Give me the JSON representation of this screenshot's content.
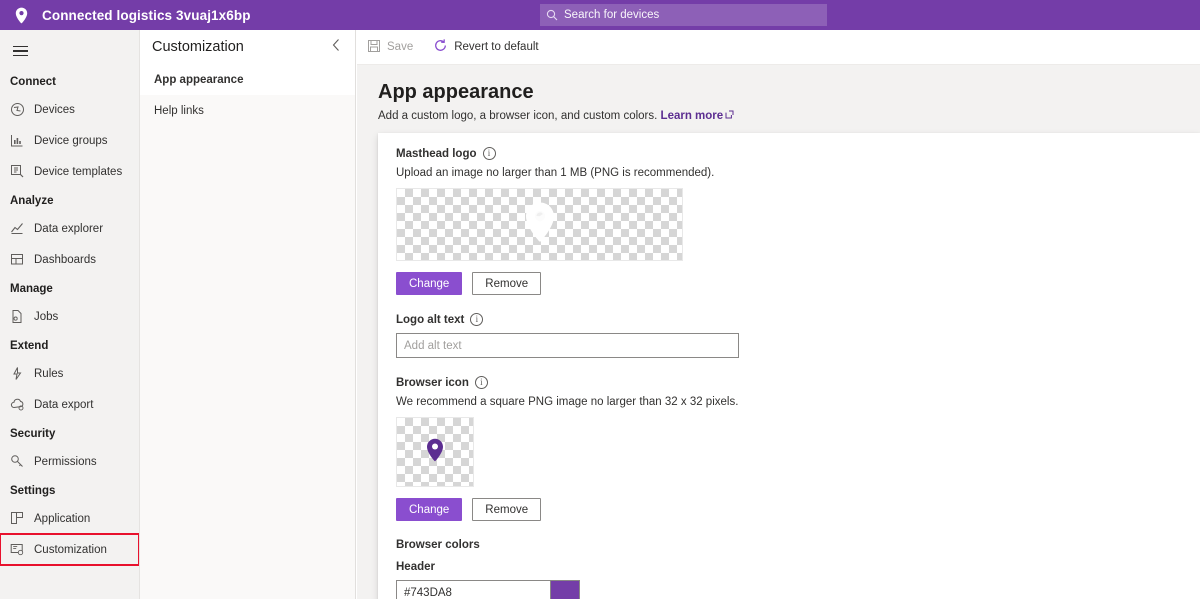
{
  "topbar": {
    "brand_icon": "map-pin-icon",
    "app_title": "Connected logistics 3vuaj1x6bp",
    "search": {
      "icon": "search-icon",
      "placeholder": "Search for devices",
      "value": ""
    },
    "background_color": "#743DA8"
  },
  "leftnav": {
    "hamburger_icon": "hamburger-menu-icon",
    "sections": [
      {
        "group": "Connect",
        "items": [
          {
            "label": "Devices",
            "icon": "devices-icon",
            "highlighted": false
          },
          {
            "label": "Device groups",
            "icon": "device-groups-icon",
            "highlighted": false
          },
          {
            "label": "Device templates",
            "icon": "device-templates-icon",
            "highlighted": false
          }
        ]
      },
      {
        "group": "Analyze",
        "items": [
          {
            "label": "Data explorer",
            "icon": "data-explorer-icon",
            "highlighted": false
          },
          {
            "label": "Dashboards",
            "icon": "dashboards-icon",
            "highlighted": false
          }
        ]
      },
      {
        "group": "Manage",
        "items": [
          {
            "label": "Jobs",
            "icon": "jobs-icon",
            "highlighted": false
          }
        ]
      },
      {
        "group": "Extend",
        "items": [
          {
            "label": "Rules",
            "icon": "rules-icon",
            "highlighted": false
          },
          {
            "label": "Data export",
            "icon": "data-export-icon",
            "highlighted": false
          }
        ]
      },
      {
        "group": "Security",
        "items": [
          {
            "label": "Permissions",
            "icon": "permissions-key-icon",
            "highlighted": false
          }
        ]
      },
      {
        "group": "Settings",
        "items": [
          {
            "label": "Application",
            "icon": "application-icon",
            "highlighted": false
          },
          {
            "label": "Customization",
            "icon": "customization-icon",
            "highlighted": true
          }
        ]
      }
    ],
    "highlight_color": "#e8112d"
  },
  "subpanel": {
    "title": "Customization",
    "collapse_icon": "chevron-left-icon",
    "items": [
      {
        "label": "App appearance",
        "active": true
      },
      {
        "label": "Help links",
        "active": false
      }
    ]
  },
  "commandbar": {
    "save": {
      "label": "Save",
      "icon": "save-disk-icon",
      "disabled": true
    },
    "revert": {
      "label": "Revert to default",
      "icon": "refresh-circle-icon",
      "disabled": false
    }
  },
  "main": {
    "heading": "App appearance",
    "subtitle_text": "Add a custom logo, a browser icon, and custom colors.",
    "learn_more": "Learn more",
    "learn_more_icon": "external-link-icon",
    "masthead": {
      "label": "Masthead logo",
      "info_icon": "info-icon",
      "help": "Upload an image no larger than 1 MB (PNG is recommended).",
      "preview_icon": "map-pin-icon-white",
      "change_label": "Change",
      "remove_label": "Remove"
    },
    "logo_alt": {
      "label": "Logo alt text",
      "info_icon": "info-icon",
      "placeholder": "Add alt text",
      "value": ""
    },
    "browser_icon": {
      "label": "Browser icon",
      "info_icon": "info-icon",
      "help": "We recommend a square PNG image no larger than 32 x 32 pixels.",
      "preview_icon": "map-pin-icon-purple",
      "change_label": "Change",
      "remove_label": "Remove"
    },
    "browser_colors": {
      "section_label": "Browser colors",
      "header_label": "Header",
      "header_value": "#743DA8",
      "header_swatch_color": "#743DA8"
    }
  },
  "theme": {
    "brand_purple": "#743DA8",
    "button_purple": "#8A4ECF",
    "link_purple": "#5C2E91",
    "nav_bg": "#f3f2f1",
    "content_bg": "#f3f2f1"
  }
}
